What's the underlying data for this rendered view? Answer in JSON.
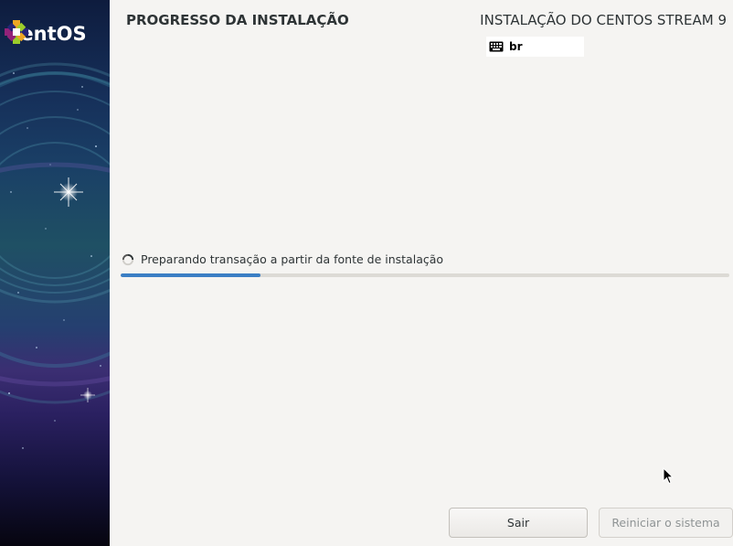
{
  "sidebar": {
    "logo_text": "CentOS"
  },
  "header": {
    "title": "PROGRESSO DA INSTALAÇÃO",
    "product": "INSTALAÇÃO DO CENTOS STREAM 9",
    "keyboard_layout": "br"
  },
  "progress": {
    "status_text": "Preparando transação a partir da fonte de instalação",
    "fraction": 0.23
  },
  "buttons": {
    "quit_label": "Sair",
    "reboot_label": "Reiniciar o sistema"
  },
  "colors": {
    "progress_fill": "#3b7fc4",
    "background": "#f5f4f2"
  },
  "icons": [
    "centos-logo-icon",
    "keyboard-icon",
    "spinner-icon",
    "mouse-cursor-icon"
  ]
}
